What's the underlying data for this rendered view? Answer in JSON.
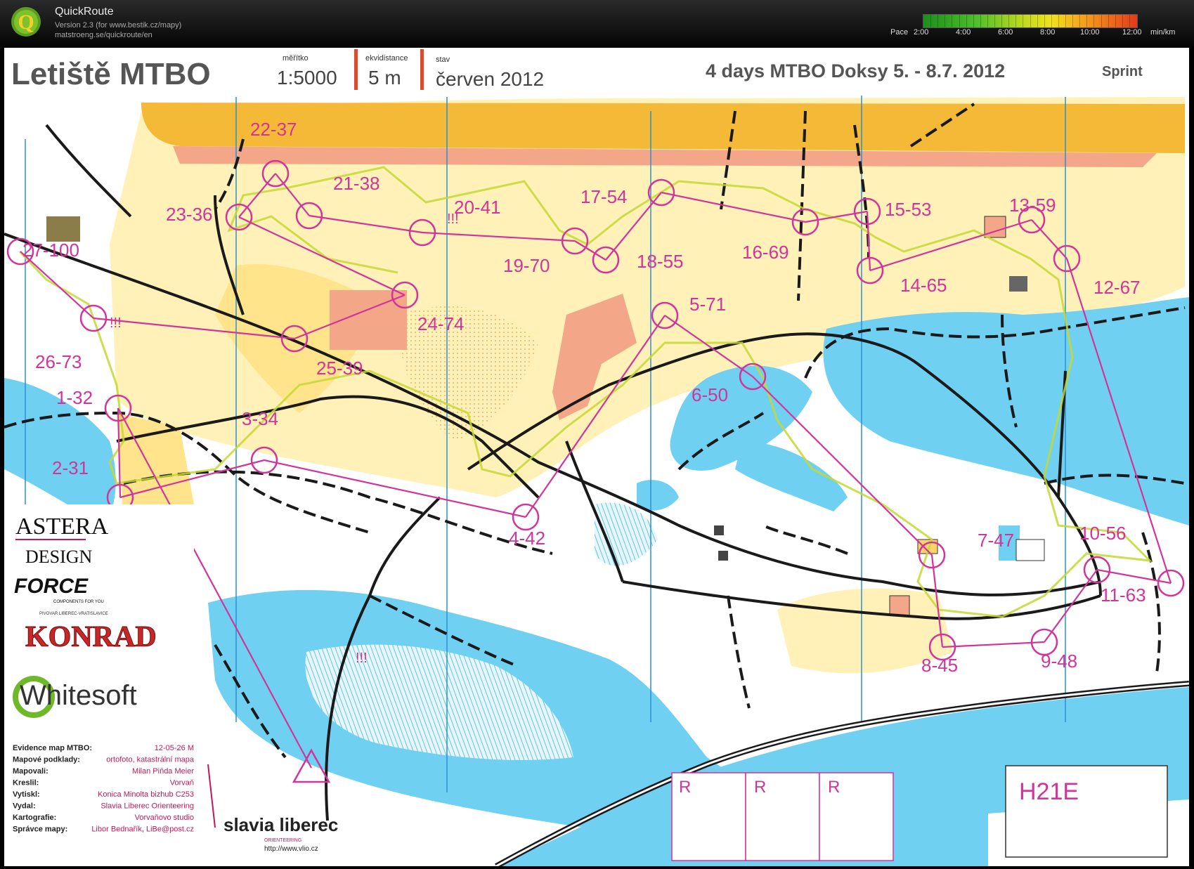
{
  "app": {
    "name": "QuickRoute",
    "version": "Version 2.3  (for www.bestik.cz/mapy)",
    "url": "matstroeng.se/quickroute/en"
  },
  "pace_legend": {
    "label": "Pace",
    "ticks": [
      "2:00",
      "4:00",
      "6:00",
      "8:00",
      "10:00",
      "12:00"
    ],
    "unit": "min/km"
  },
  "map_header": {
    "title": "Letiště MTBO",
    "scale_caption": "měřítko",
    "scale": "1:5000",
    "contour_caption": "ekvidistance",
    "contour": "5 m",
    "state_caption": "stav",
    "state": "červen 2012",
    "event": "4 days  MTBO Doksy 5. - 8.7. 2012",
    "event_type": "Sprint"
  },
  "controls": [
    {
      "label": "1-32"
    },
    {
      "label": "2-31"
    },
    {
      "label": "3-34"
    },
    {
      "label": "4-42"
    },
    {
      "label": "5-71"
    },
    {
      "label": "6-50"
    },
    {
      "label": "7-47"
    },
    {
      "label": "8-45"
    },
    {
      "label": "9-48"
    },
    {
      "label": "10-56"
    },
    {
      "label": "11-63"
    },
    {
      "label": "12-67"
    },
    {
      "label": "13-59"
    },
    {
      "label": "14-65"
    },
    {
      "label": "15-53"
    },
    {
      "label": "16-69"
    },
    {
      "label": "17-54"
    },
    {
      "label": "18-55"
    },
    {
      "label": "19-70"
    },
    {
      "label": "20-41"
    },
    {
      "label": "21-38"
    },
    {
      "label": "22-37"
    },
    {
      "label": "23-36"
    },
    {
      "label": "24-74"
    },
    {
      "label": "25-39"
    },
    {
      "label": "26-73"
    },
    {
      "label": "27-100"
    }
  ],
  "warnings": [
    "!!!",
    "!!!",
    "!!!"
  ],
  "sponsors": {
    "astera_1": "ASTERA",
    "astera_2": "DESIGN",
    "force": "FORCE",
    "force_sub": "COMPONENTS FOR YOU",
    "konrad_top": "PIVOVAR LIBEREC-VRATISLAVICE",
    "konrad": "KONRAD",
    "whitesoft": "Whitesoft",
    "slavia": "slavia liberec",
    "slavia_sub": "ORIENTEERING",
    "slavia_url": "http://www.vlio.cz"
  },
  "credits": [
    {
      "key": "Evidence map MTBO:",
      "value": "12-05-26 M"
    },
    {
      "key": "Mapové podklady:",
      "value": "ortofoto, katastrální mapa"
    },
    {
      "key": "Mapovali:",
      "value": "Milan Piňda Meier"
    },
    {
      "key": "Kreslil:",
      "value": "Vorvaň"
    },
    {
      "key": "Vytiskl:",
      "value": "Konica Minolta bizhub C253"
    },
    {
      "key": "Vydal:",
      "value": "Slavia Liberec Orienteering"
    },
    {
      "key": "Kartografie:",
      "value": "Vorvaňovo studio"
    },
    {
      "key": "Správce mapy:",
      "value": "Libor Bednařík, LiBe@post.cz"
    }
  ],
  "reserve_boxes": [
    "R",
    "R",
    "R"
  ],
  "category": "H21E"
}
